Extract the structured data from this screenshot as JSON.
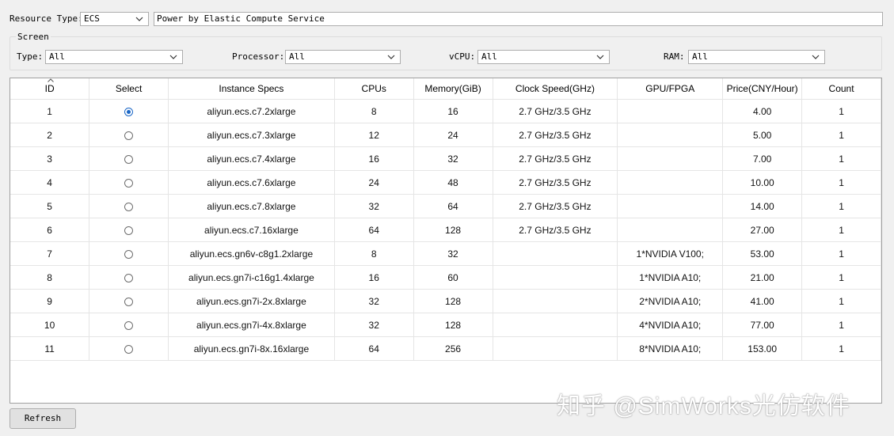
{
  "top": {
    "resource_type_label": "Resource Type:",
    "resource_type_value": "ECS",
    "description": "Power by Elastic Compute Service"
  },
  "screen": {
    "title": "Screen",
    "type_label": "Type:",
    "type_value": "All",
    "processor_label": "Processor:",
    "processor_value": "All",
    "vcpu_label": "vCPU:",
    "vcpu_value": "All",
    "ram_label": "RAM:",
    "ram_value": "All"
  },
  "table": {
    "columns": [
      "ID",
      "Select",
      "Instance Specs",
      "CPUs",
      "Memory(GiB)",
      "Clock Speed(GHz)",
      "GPU/FPGA",
      "Price(CNY/Hour)",
      "Count"
    ],
    "rows": [
      {
        "id": "1",
        "selected": true,
        "spec": "aliyun.ecs.c7.2xlarge",
        "cpus": "8",
        "memory": "16",
        "clock": "2.7 GHz/3.5 GHz",
        "gpu": "",
        "price": "4.00",
        "count": "1"
      },
      {
        "id": "2",
        "selected": false,
        "spec": "aliyun.ecs.c7.3xlarge",
        "cpus": "12",
        "memory": "24",
        "clock": "2.7 GHz/3.5 GHz",
        "gpu": "",
        "price": "5.00",
        "count": "1"
      },
      {
        "id": "3",
        "selected": false,
        "spec": "aliyun.ecs.c7.4xlarge",
        "cpus": "16",
        "memory": "32",
        "clock": "2.7 GHz/3.5 GHz",
        "gpu": "",
        "price": "7.00",
        "count": "1"
      },
      {
        "id": "4",
        "selected": false,
        "spec": "aliyun.ecs.c7.6xlarge",
        "cpus": "24",
        "memory": "48",
        "clock": "2.7 GHz/3.5 GHz",
        "gpu": "",
        "price": "10.00",
        "count": "1"
      },
      {
        "id": "5",
        "selected": false,
        "spec": "aliyun.ecs.c7.8xlarge",
        "cpus": "32",
        "memory": "64",
        "clock": "2.7 GHz/3.5 GHz",
        "gpu": "",
        "price": "14.00",
        "count": "1"
      },
      {
        "id": "6",
        "selected": false,
        "spec": "aliyun.ecs.c7.16xlarge",
        "cpus": "64",
        "memory": "128",
        "clock": "2.7 GHz/3.5 GHz",
        "gpu": "",
        "price": "27.00",
        "count": "1"
      },
      {
        "id": "7",
        "selected": false,
        "spec": "aliyun.ecs.gn6v-c8g1.2xlarge",
        "cpus": "8",
        "memory": "32",
        "clock": "",
        "gpu": "1*NVIDIA V100;",
        "price": "53.00",
        "count": "1"
      },
      {
        "id": "8",
        "selected": false,
        "spec": "aliyun.ecs.gn7i-c16g1.4xlarge",
        "cpus": "16",
        "memory": "60",
        "clock": "",
        "gpu": "1*NVIDIA A10;",
        "price": "21.00",
        "count": "1"
      },
      {
        "id": "9",
        "selected": false,
        "spec": "aliyun.ecs.gn7i-2x.8xlarge",
        "cpus": "32",
        "memory": "128",
        "clock": "",
        "gpu": "2*NVIDIA A10;",
        "price": "41.00",
        "count": "1"
      },
      {
        "id": "10",
        "selected": false,
        "spec": "aliyun.ecs.gn7i-4x.8xlarge",
        "cpus": "32",
        "memory": "128",
        "clock": "",
        "gpu": "4*NVIDIA A10;",
        "price": "77.00",
        "count": "1"
      },
      {
        "id": "11",
        "selected": false,
        "spec": "aliyun.ecs.gn7i-8x.16xlarge",
        "cpus": "64",
        "memory": "256",
        "clock": "",
        "gpu": "8*NVIDIA A10;",
        "price": "153.00",
        "count": "1"
      }
    ]
  },
  "refresh_label": "Refresh",
  "watermark": "知乎 @SimWorks光仿软件",
  "colors": {
    "selected_radio": "#1b67c6",
    "grid_line": "#e5e5e5"
  }
}
